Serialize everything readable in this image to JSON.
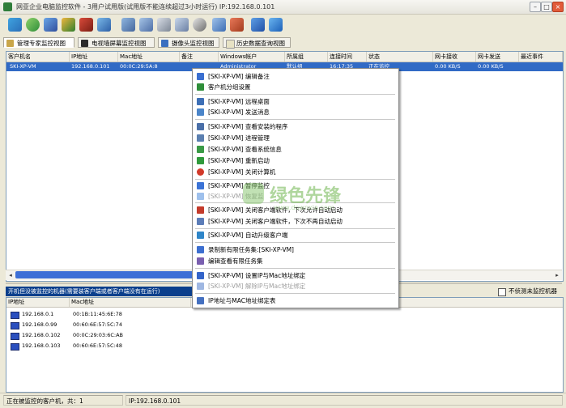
{
  "window": {
    "title": "网亚企业电脑监控软件 - 3用户试用版(试用版不能连续超过3小时运行) IP:192.168.0.101"
  },
  "tabs": [
    {
      "label": "管理专家监控视图"
    },
    {
      "label": "电视墙屏幕监控视图"
    },
    {
      "label": "摄像头监控视图"
    },
    {
      "label": "历史数据查询视图"
    }
  ],
  "grid": {
    "columns": [
      "客户机名",
      "IP地址",
      "Mac地址",
      "备注",
      "Windows帐户",
      "所属组",
      "连接时间",
      "状态",
      "网卡接收",
      "网卡发送",
      "最近事件"
    ],
    "row": {
      "name": "SKI-XP-VM",
      "ip": "192.168.0.101",
      "mac": "00:0C:29:5A:8",
      "note": "",
      "account": "Administrator",
      "group": "默认组",
      "time": "16:17:35",
      "status": "正在监控",
      "rx": "0.00 KB/S",
      "tx": "0.00 KB/S",
      "event": ""
    }
  },
  "context_menu": {
    "items": [
      {
        "label": "[SKI-XP-VM] 编辑备注",
        "icon": "pencil-icon",
        "color": "#3a6fd0"
      },
      {
        "label": "客户机分组设置",
        "icon": "group-icon",
        "color": "#2f8f3a"
      },
      {
        "label": "[SKI-XP-VM] 远程桌面",
        "icon": "remote-desktop-icon",
        "color": "#3d6fb6"
      },
      {
        "label": "[SKI-XP-VM] 发送消息",
        "icon": "message-icon",
        "color": "#4b85c9"
      },
      {
        "label": "[SKI-XP-VM] 查看安装的程序",
        "icon": "programs-icon",
        "color": "#4a6fa8"
      },
      {
        "label": "[SKI-XP-VM] 进程管理",
        "icon": "process-icon",
        "color": "#5b7fb0"
      },
      {
        "label": "[SKI-XP-VM] 查看系统信息",
        "icon": "system-info-icon",
        "color": "#3a9a46"
      },
      {
        "label": "[SKI-XP-VM] 重新启动",
        "icon": "restart-icon",
        "color": "#2f9a3c"
      },
      {
        "label": "[SKI-XP-VM] 关闭计算机",
        "icon": "power-icon",
        "color": "#d23a2a"
      },
      {
        "label": "[SKI-XP-VM] 暂停监控",
        "icon": "pause-icon",
        "color": "#3b73d6"
      },
      {
        "label": "[SKI-XP-VM] 恢复监",
        "icon": "play-icon",
        "color": "#9ec0ec"
      },
      {
        "label": "[SKI-XP-VM] 关闭客户端软件，下次允许自动启动",
        "icon": "close-client-icon",
        "color": "#c43b2b"
      },
      {
        "label": "[SKI-XP-VM] 关闭客户端软件，下次不再自动启动",
        "icon": "close-client-icon",
        "color": "#5c7db8"
      },
      {
        "label": "[SKI-XP-VM] 自动升级客户端",
        "icon": "upgrade-icon",
        "color": "#2f86c9"
      },
      {
        "label": "录制新有限任务集:[SKI-XP-VM]",
        "icon": "record-icon",
        "color": "#3d6fd0"
      },
      {
        "label": "编辑查看有限任务集",
        "icon": "edit-task-icon",
        "color": "#7a5fb0"
      },
      {
        "label": "[SKI-XP-VM] 设置IP与Mac地址绑定",
        "icon": "lock-icon",
        "color": "#3464c9"
      },
      {
        "label": "[SKI-XP-VM] 解除IP与Mac地址绑定",
        "icon": "unlock-icon",
        "color": "#9fb7e2"
      },
      {
        "label": "IP地址与MAC地址绑定表",
        "icon": "table-icon",
        "color": "#4470c0"
      }
    ]
  },
  "lower": {
    "warning": "开机但没被监控的机器(需要装客户端或者客户端没有在运行)",
    "checkbox_label": "不侦测未监控机器",
    "columns": [
      "IP地址",
      "Mac地址"
    ],
    "rows": [
      {
        "ip": "192.168.0.1",
        "mac": "00:1B:11:45:6E:78"
      },
      {
        "ip": "192.168.0.99",
        "mac": "00:60:6E:57:5C:74"
      },
      {
        "ip": "192.168.0.102",
        "mac": "00:0C:29:03:6C:AB"
      },
      {
        "ip": "192.168.0.103",
        "mac": "00:60:6E:57:5C:48"
      }
    ]
  },
  "statusbar": {
    "left": "正在被监控的客户机，共：1",
    "right": "IP:192.168.0.101"
  },
  "watermark": {
    "text": "绿色先锋",
    "url": "www.downxia.com"
  },
  "colors": {
    "selection": "#316ac5",
    "warning_bg": "#0b3f8c"
  }
}
